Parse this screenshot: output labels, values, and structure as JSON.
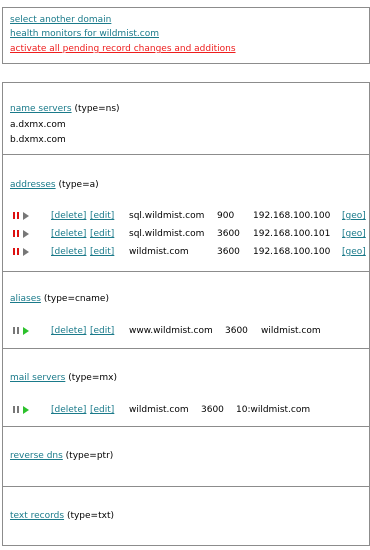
{
  "top_links": {
    "select_domain": "select another domain",
    "health_monitors": "health monitors for wildmist.com",
    "activate": "activate all pending record changes and additions"
  },
  "colors": {
    "link": "#1a7a8a",
    "alert_link": "#ee1d1d",
    "status_red": "#dd1111",
    "status_gray": "#777777",
    "status_green": "#2cc12c"
  },
  "actions": {
    "delete": "[delete]",
    "edit": "[edit]",
    "geo": "[geo]"
  },
  "sections": {
    "ns": {
      "link": "name servers",
      "type": "(type=ns)",
      "values": [
        "a.dxmx.com",
        "b.dxmx.com"
      ]
    },
    "a": {
      "link": "addresses",
      "type": "(type=a)",
      "records": [
        {
          "status": "paused",
          "host": "sql.wildmist.com",
          "ttl": "900",
          "value": "192.168.100.100"
        },
        {
          "status": "paused",
          "host": "sql.wildmist.com",
          "ttl": "3600",
          "value": "192.168.100.101"
        },
        {
          "status": "paused",
          "host": "wildmist.com",
          "ttl": "3600",
          "value": "192.168.100.100"
        }
      ]
    },
    "cname": {
      "link": "aliases",
      "type": "(type=cname)",
      "records": [
        {
          "status": "active",
          "host": "www.wildmist.com",
          "ttl": "3600",
          "value": "wildmist.com"
        }
      ]
    },
    "mx": {
      "link": "mail servers",
      "type": "(type=mx)",
      "records": [
        {
          "status": "active",
          "host": "wildmist.com",
          "ttl": "3600",
          "value": "10:wildmist.com"
        }
      ]
    },
    "ptr": {
      "link": "reverse dns",
      "type": "(type=ptr)"
    },
    "txt": {
      "link": "text records",
      "type": "(type=txt)"
    }
  }
}
